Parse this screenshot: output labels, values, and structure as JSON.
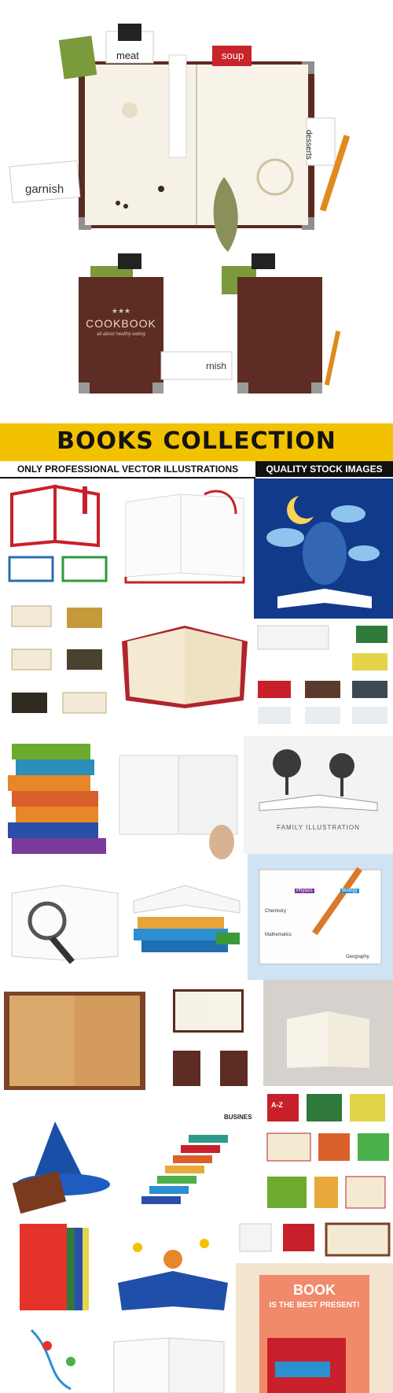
{
  "hero": {
    "tabs": {
      "meat": "meat",
      "soup": "soup",
      "desserts": "desserts",
      "garnish": "garnish",
      "garnish_small": "rnish"
    },
    "cover": {
      "stars": "★★★",
      "title": "COOKBOOK",
      "subtitle": "all about healthy eating"
    }
  },
  "banner": {
    "title": "BOOKS COLLECTION",
    "left_subtitle": "ONLY PROFESSIONAL VECTOR ILLUSTRATIONS",
    "right_subtitle": "QUALITY STOCK IMAGES"
  },
  "gallery": {
    "family_illustration": "FAMILY ILLUSTRATION",
    "business": "BUSINESS",
    "az": "A-Z",
    "book_present_title": "BOOK",
    "book_present_sub": "IS THE BEST PRESENT!",
    "diagram_labels": [
      "Physics",
      "Biology",
      "Chemistry",
      "Mathematics",
      "Geography"
    ]
  },
  "colors": {
    "banner": "#f2c200",
    "leather": "#5b2b22",
    "paper": "#f6f1e4",
    "night_sky": "#123a8a"
  }
}
